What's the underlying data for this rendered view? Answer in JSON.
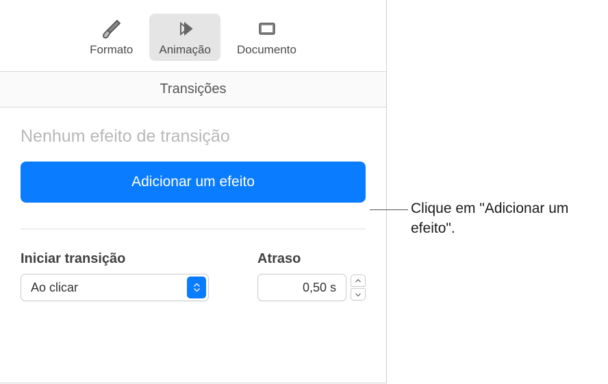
{
  "toolbar": {
    "format_label": "Formato",
    "animation_label": "Animação",
    "document_label": "Documento"
  },
  "section_header": "Transições",
  "no_effect": "Nenhum efeito de transição",
  "add_effect_button": "Adicionar um efeito",
  "controls": {
    "start_label": "Iniciar transição",
    "start_value": "Ao clicar",
    "delay_label": "Atraso",
    "delay_value": "0,50 s"
  },
  "callout": "Clique em \"Adicionar um efeito\"."
}
